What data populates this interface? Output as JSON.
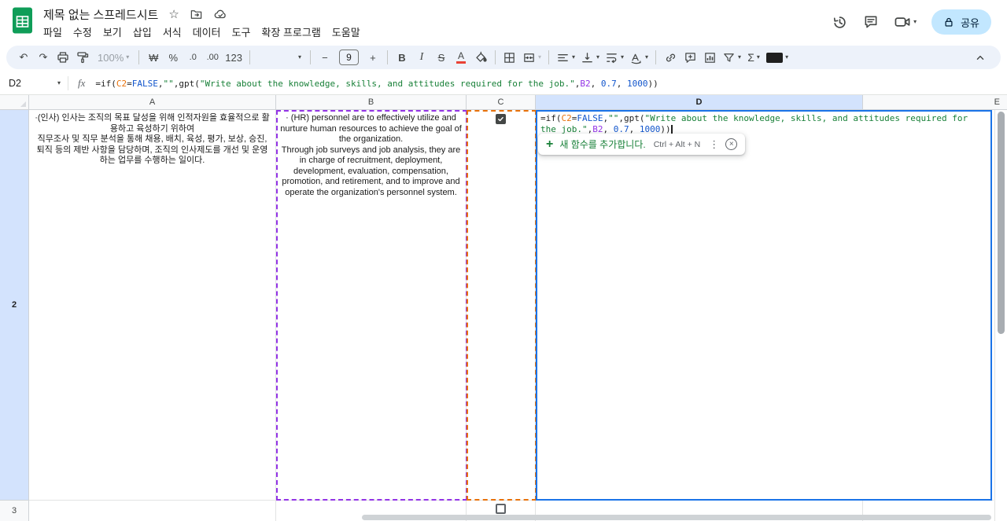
{
  "header": {
    "doc_title": "제목 없는 스프레드시트",
    "star": "☆",
    "menus": [
      "파일",
      "수정",
      "보기",
      "삽입",
      "서식",
      "데이터",
      "도구",
      "확장 프로그램",
      "도움말"
    ],
    "share_label": "공유"
  },
  "toolbar": {
    "undo": "↶",
    "redo": "↷",
    "zoom": "100%",
    "currency": "₩",
    "percent": "%",
    "decrease_decimal": ".0",
    "increase_decimal": ".00",
    "more_formats": "123",
    "minus": "−",
    "font_size": "9",
    "plus": "+",
    "bold": "B",
    "italic": "I",
    "strike": "S",
    "text_color": "A",
    "sigma": "Σ",
    "caret": "▾"
  },
  "formula_bar": {
    "name_box": "D2",
    "fx_label": "fx"
  },
  "formula": {
    "tokens": [
      {
        "t": "=if(",
        "c": "default"
      },
      {
        "t": "C2",
        "c": "ref1"
      },
      {
        "t": "=",
        "c": "default"
      },
      {
        "t": "FALSE",
        "c": "literal"
      },
      {
        "t": ",",
        "c": "default"
      },
      {
        "t": "\"\"",
        "c": "string"
      },
      {
        "t": ",gpt(",
        "c": "default"
      },
      {
        "t": "\"Write about the knowledge, skills, and attitudes required for the job.\"",
        "c": "string"
      },
      {
        "t": ",",
        "c": "default"
      },
      {
        "t": "B2",
        "c": "ref2"
      },
      {
        "t": ", ",
        "c": "default"
      },
      {
        "t": "0.7",
        "c": "literal"
      },
      {
        "t": ", ",
        "c": "default"
      },
      {
        "t": "1000",
        "c": "literal"
      },
      {
        "t": "))",
        "c": "default"
      }
    ],
    "token_colors": {
      "default": "#1f1f1f",
      "ref1": "#e8710a",
      "ref2": "#9334e6",
      "string": "#188038",
      "literal": "#1155cc"
    }
  },
  "popup": {
    "plus": "+",
    "label": "새 함수를 추가합니다.",
    "shortcut": "Ctrl + Alt + N",
    "more": "⋮",
    "close": "×"
  },
  "grid": {
    "columns": [
      "A",
      "B",
      "C",
      "D",
      "E"
    ],
    "rows": [
      "2",
      "3"
    ],
    "cells": {
      "A2": "·(인사) 인사는 조직의 목표 달성을 위해 인적자원을 효율적으로 활용하고 육성하기 위하여\n직무조사 및 직무 분석을 통해 채용, 배치, 육성, 평가, 보상, 승진, 퇴직 등의 제반 사항을 담당하며, 조직의 인사제도를 개선 및 운영하는 업무를 수행하는 일이다.",
      "B2": "· (HR) personnel are to effectively utilize and nurture human resources to achieve the goal of the organization.\nThrough job surveys and job analysis, they are in charge of recruitment, deployment, development, evaluation, compensation, promotion, and retirement, and to improve and operate the organization's personnel system.",
      "C2_checkbox": true,
      "C3_checkbox": false
    }
  },
  "colors": {
    "accent_blue": "#1a73e8",
    "share_bg": "#c2e7ff",
    "toolbar_bg": "#edf2fa",
    "selected_header_bg": "#d3e3fd",
    "checkbox": "#444746",
    "suggestion_green": "#188038"
  }
}
